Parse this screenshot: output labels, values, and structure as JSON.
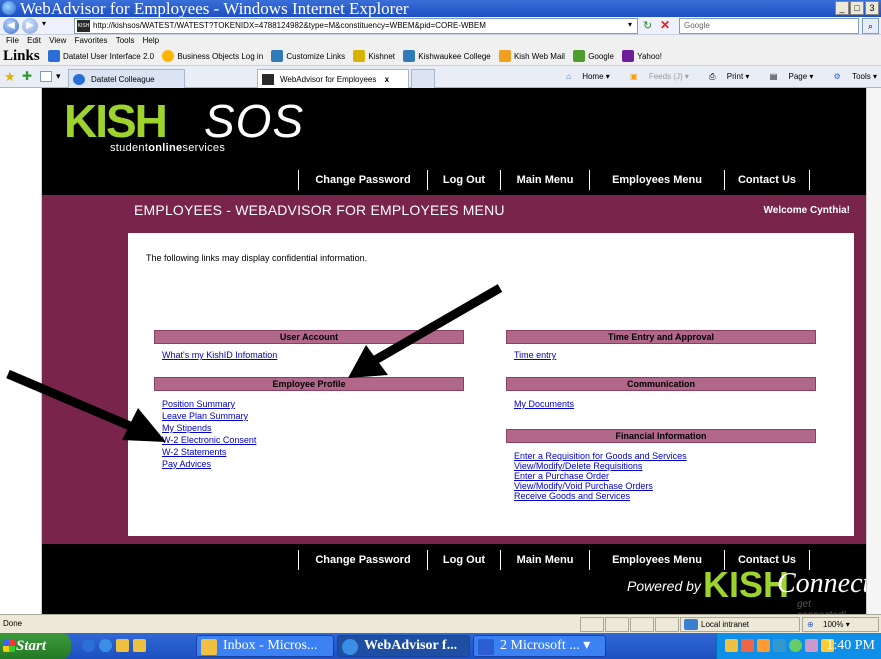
{
  "window": {
    "title": "WebAdvisor for Employees - Windows Internet Explorer",
    "min": "_",
    "max": "□",
    "close": "3"
  },
  "address": {
    "url": "http://kishsos/WATEST/WATEST?TOKENIDX=4788124982&type=M&constituency=WBEM&pid=CORE-WBEM",
    "search_placeholder": "Google"
  },
  "menu": [
    "File",
    "Edit",
    "View",
    "Favorites",
    "Tools",
    "Help"
  ],
  "links_bar": {
    "label": "Links",
    "items": [
      {
        "label": "Datatel User Interface 2.0",
        "color": "#2b6fd6"
      },
      {
        "label": "Business Objects Log in",
        "color": "#ffb400"
      },
      {
        "label": "Customize Links",
        "color": "#2f7ab8"
      },
      {
        "label": "Kishnet",
        "color": "#d9b200"
      },
      {
        "label": "Kishwaukee College",
        "color": "#2f7ab8"
      },
      {
        "label": "Kish Web Mail",
        "color": "#f0a020"
      },
      {
        "label": "Google",
        "color": "#4c9e2f"
      },
      {
        "label": "Yahoo!",
        "color": "#6b1f9c"
      }
    ]
  },
  "tabs": [
    {
      "label": "Datatel Colleague"
    },
    {
      "label": "WebAdvisor for Employees",
      "close": "x"
    }
  ],
  "toolbar_right": {
    "home": "Home",
    "feeds": "Feeds (J)",
    "print": "Print",
    "page": "Page",
    "tools": "Tools"
  },
  "site": {
    "logo_left": "KISH",
    "logo_right": "SOS",
    "logo_sub_a": "student",
    "logo_sub_b": "online",
    "logo_sub_c": "services",
    "nav": [
      "Change Password",
      "Log Out",
      "Main Menu",
      "Employees Menu",
      "Contact Us"
    ],
    "header_title": "Employees - WebAdvisor for Employees Menu",
    "welcome": "Welcome Cynthia!",
    "notice": "The following links may display confidential information.",
    "sections": {
      "user_account": {
        "title": "User Account",
        "links": [
          "What's my KishID Infomation"
        ]
      },
      "employee_profile": {
        "title": "Employee Profile",
        "links": [
          "Position Summary",
          "Leave Plan Summary",
          "My Stipends",
          "W-2 Electronic Consent",
          "W-2 Statements",
          "Pay Advices"
        ]
      },
      "time_entry": {
        "title": "Time Entry and Approval",
        "links": [
          "Time entry"
        ]
      },
      "communication": {
        "title": "Communication",
        "links": [
          "My Documents"
        ]
      },
      "financial": {
        "title": "Financial Information",
        "links": [
          "Enter a Requisition for Goods and Services",
          "View/Modify/Delete Requisitions",
          "Enter a Purchase Order",
          "View/Modify/Void Purchase Orders",
          "Receive Goods and Services"
        ]
      }
    },
    "powered_by": "Powered by",
    "powered_kish": "KISH",
    "powered_connect": "Connect",
    "powered_tag": "get connected!"
  },
  "status": {
    "left": "Done",
    "zone": "Local intranet",
    "zoom": "100%"
  },
  "taskbar": {
    "start": "Start",
    "buttons": [
      {
        "label": "Inbox - Micros...",
        "color": "#f0c040"
      },
      {
        "label": "WebAdvisor f...",
        "color": "#3a8ee6"
      },
      {
        "label": "2 Microsoft ...",
        "color": "#2b5fcf"
      }
    ],
    "clock": "1:40 PM"
  }
}
